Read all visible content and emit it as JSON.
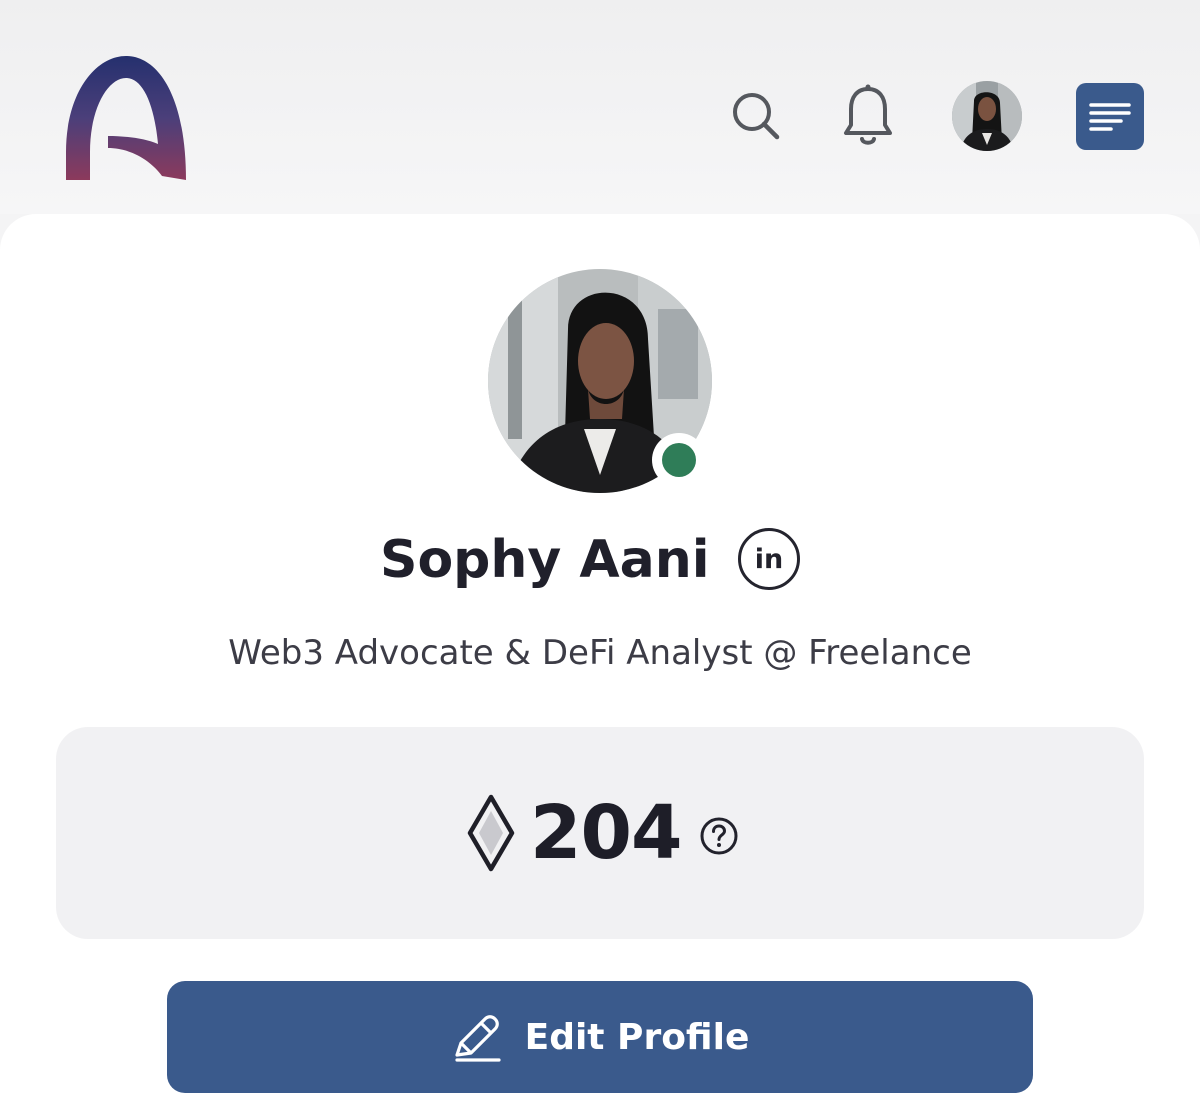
{
  "header": {
    "logo_icon": "arch-a-logo",
    "search_icon": "search-icon",
    "notifications_icon": "bell-icon",
    "menu_icon": "menu-lines-icon",
    "menu_color": "#3a5a8c"
  },
  "profile": {
    "name": "Sophy Aani",
    "linkedin_label": "in",
    "headline": "Web3 Advocate & DeFi Analyst @ Freelance",
    "online_status_color": "#2f7d58"
  },
  "points": {
    "icon": "diamond-icon",
    "value": "204",
    "help_icon": "question-circle-icon"
  },
  "actions": {
    "edit_profile_label": "Edit Profile",
    "edit_icon": "pencil-icon",
    "button_color": "#3a5a8c"
  }
}
